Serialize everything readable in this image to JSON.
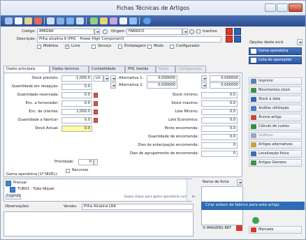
{
  "window": {
    "title": "Fichas Técnicas de Artigos"
  },
  "header": {
    "codigo_label": "Código:",
    "codigo_value": "AMIGRA",
    "origem_label": "Origem:",
    "origem_value": "FABRICO",
    "inactivo_label": "Inactivo",
    "descricao_label": "Descrição:",
    "descricao_value": "Pilha alcalina 9 (PHC - Power High Component)",
    "checks": [
      {
        "label": "Mobiliza",
        "checked": false
      },
      {
        "label": "Livre",
        "checked": true
      },
      {
        "label": "Serviço",
        "checked": false
      },
      {
        "label": "Embalagem",
        "checked": false
      },
      {
        "label": "Modo",
        "checked": false
      },
      {
        "label": "Configurador",
        "checked": false
      }
    ]
  },
  "tabs": [
    {
      "label": "Dados principais",
      "state": "active"
    },
    {
      "label": "Dados técnicos",
      "state": "normal"
    },
    {
      "label": "Contabilidade",
      "state": "normal"
    },
    {
      "label": "PHC Gestão",
      "state": "normal"
    },
    {
      "label": "Notas",
      "state": "disabled"
    },
    {
      "label": "Configuração",
      "state": "disabled"
    }
  ],
  "left_fields": [
    {
      "label": "Stock previsto:",
      "value": "-1,000.0"
    },
    {
      "label": "Quantidade em recepção:",
      "value": "0.0"
    },
    {
      "label": "Quantidade reservada:",
      "value": "0.0"
    },
    {
      "label": "Enc. a fornecedor:",
      "value": "0.0"
    },
    {
      "label": "Enc. de clientes:",
      "value": "1,000.0"
    },
    {
      "label": "Quantidade a fabricar:",
      "value": "0.0"
    },
    {
      "label": "Stock Actual:",
      "value": "0.0"
    }
  ],
  "unit": {
    "value": "Ltr"
  },
  "alternativas": [
    {
      "label": "Alternativa 1:",
      "v1": "0.000000",
      "v2": "0.000000"
    },
    {
      "label": "Alternativa 2:",
      "v1": "0.000000",
      "v2": "0.000000"
    }
  ],
  "mid_fields": [
    {
      "label": "Stock mínimo:",
      "value": "0.0"
    },
    {
      "label": "Stock máximo:",
      "value": "0.0"
    },
    {
      "label": "Lote Mínimo:",
      "value": "0.0"
    },
    {
      "label": "Lote Económico:",
      "value": "0.0"
    },
    {
      "label": "Ponto encomenda:",
      "value": "0.0"
    },
    {
      "label": "Quantidade de encomenda:",
      "value": "0.0"
    },
    {
      "label": "Dias de antecipação encomenda:",
      "value": "0"
    },
    {
      "label": "Dias de agrupamento de encomenda:",
      "value": "0"
    }
  ],
  "prioridade": {
    "label": "Prioridade:",
    "value": "0"
  },
  "recursos": {
    "label": "Recursos",
    "checked": false
  },
  "gama": {
    "label": "Gama operatória (1º NÍVEL):",
    "items": [
      {
        "text": "Prensar"
      },
      {
        "text": "TUB01 - Tubo Níquel"
      }
    ],
    "legend_label": "Legenda",
    "hint": "Duplo clique para gama operatória completa"
  },
  "nome_ficha": {
    "label": "Nome de ficha"
  },
  "observacoes": {
    "label": "Observações:",
    "versao_label": "Versão:",
    "versao_value": "Pilha Alcalina LR4"
  },
  "opcoes": {
    "label": "Opções deste ecrã"
  },
  "right_buttons": [
    {
      "label": "Gama operatória",
      "big": true,
      "icon_color": "#ffffff"
    },
    {
      "label": "Lista de operações",
      "big": true,
      "icon_color": "#ffffff"
    },
    {
      "label": "Imprimir",
      "big": false,
      "icon_color": "#5a7fb8"
    },
    {
      "label": "Movimentos stock",
      "big": false,
      "icon_color": "#3d8f4a"
    },
    {
      "label": "Stock à data",
      "big": false,
      "icon_color": "#3465a4"
    },
    {
      "label": "Análise utilização",
      "big": false,
      "icon_color": "#4a7bc0"
    },
    {
      "label": "Árvore artigo",
      "big": false,
      "icon_color": "#c04a3a"
    },
    {
      "label": "Cálculo de custos",
      "big": false,
      "icon_color": "#2f8f48"
    },
    {
      "label": "Gráficos",
      "big": false,
      "icon_color": "#9aa9bf",
      "dim": true
    },
    {
      "label": "Artigos alternativos",
      "big": false,
      "icon_color": "#c9a233"
    },
    {
      "label": "Localização física",
      "big": false,
      "icon_color": "#3d6fb0"
    },
    {
      "label": "Artigos Gémeos",
      "big": false,
      "icon_color": "#3d8f4a"
    }
  ],
  "context_menu": {
    "label": "Criar ordem de fabrico para esta artigo"
  },
  "imagem": {
    "label": "O IMAGENS REF"
  },
  "marcada": {
    "label": "Marcada"
  },
  "colors": {
    "toolbar": "#2c4e93",
    "selection": "#2e6db5",
    "yellow": "#fffaa0"
  }
}
